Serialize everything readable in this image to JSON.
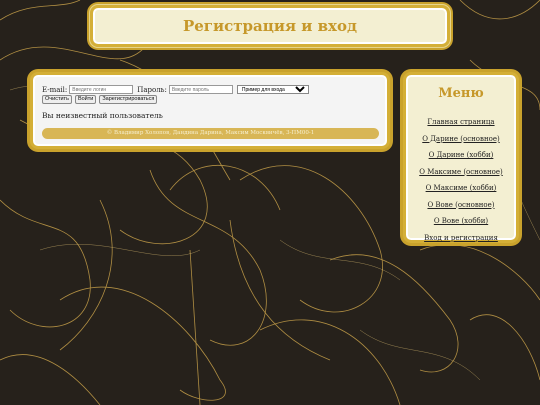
{
  "header": {
    "title": "Регистрация и вход"
  },
  "login": {
    "email_label": "E-mail:",
    "email_placeholder": "Введите логин",
    "password_label": "Пароль:",
    "password_placeholder": "Введите пароль",
    "select_value": "Пример для входа"
  },
  "buttons": {
    "clear": "Очистить",
    "login": "Войти",
    "register": "Зарегистрироваться"
  },
  "status": "Вы неизвестный пользователь",
  "footer": "© Владимир Холопов, Дандина Дарина, Максим Москвичёв, 3-ПМ00-1",
  "menu": {
    "title": "Меню",
    "items": [
      "Главная страница",
      "О Дарине (основное)",
      "О Дарине (хобби)",
      "О Максиме (основное)",
      "О Максиме (хобби)",
      "О Вове (основное)",
      "О Вове (хобби)",
      "Вход и регистрация"
    ]
  },
  "colors": {
    "accent": "#d4af37",
    "panel": "#f3efd2",
    "background": "#26211b"
  }
}
